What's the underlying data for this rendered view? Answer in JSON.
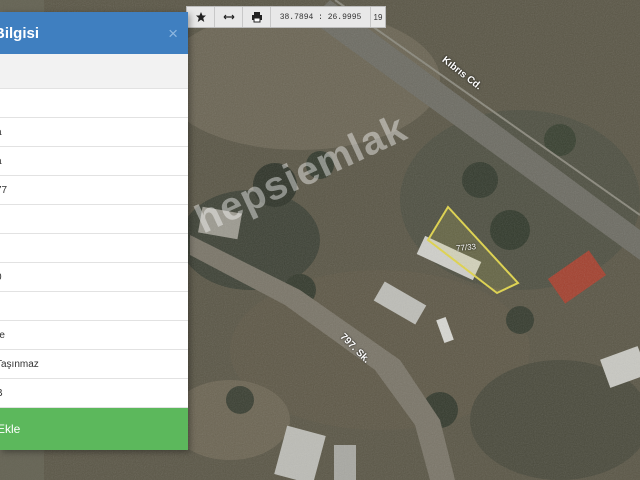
{
  "panel": {
    "title": "Bilgisi",
    "close_label": "×",
    "rows": [
      {
        "text": ""
      },
      {
        "text": ""
      },
      {
        "text": "a"
      },
      {
        "text": "a"
      },
      {
        "text": "77"
      },
      {
        "text": ""
      },
      {
        "text": ""
      },
      {
        "text": "0"
      },
      {
        "text": ""
      },
      {
        "text": "re"
      },
      {
        "text": "Taşınmaz"
      },
      {
        "text": "B"
      }
    ],
    "action_label": "Ekle"
  },
  "toolbar": {
    "coords": "38.7894 : 26.9995",
    "zoom": "19",
    "icons": [
      "star-icon",
      "measure-icon",
      "print-icon"
    ]
  },
  "map": {
    "labels": {
      "street1": "Kıbrıs Cd.",
      "street2": "797. Sk.",
      "parcel": "77/33",
      "watermark": "hepsiemlak"
    }
  }
}
